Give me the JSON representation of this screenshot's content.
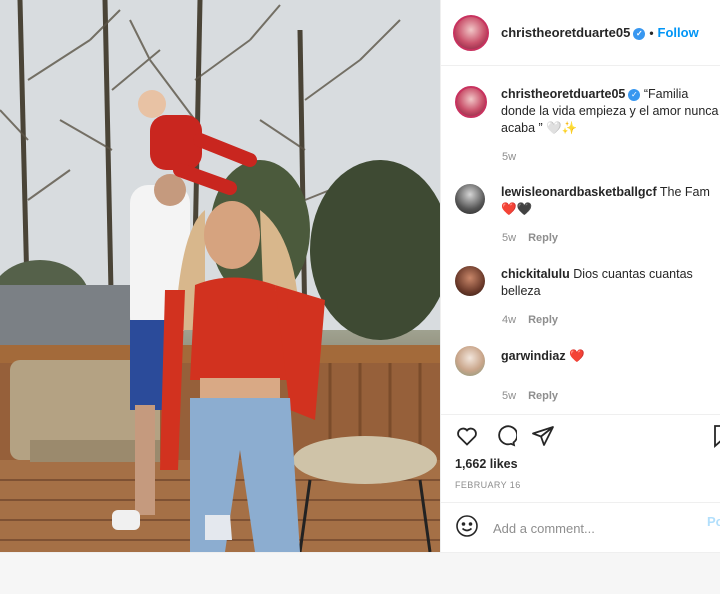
{
  "post": {
    "username": "christheoretduarte05",
    "verified_glyph": "✓",
    "dot": "•",
    "follow_label": "Follow"
  },
  "caption": {
    "username": "christheoretduarte05",
    "text": "“Familia donde la vida empieza y el amor nunca acaba ” 🤍✨",
    "time": "5w"
  },
  "comments": [
    {
      "username": "lewisleonardbasketballgcf",
      "text": "The Fam ❤️🖤",
      "time": "5w",
      "reply_label": "Reply"
    },
    {
      "username": "chickitalulu",
      "text": "Dios cuantas cuantas belleza",
      "time": "4w",
      "reply_label": "Reply"
    },
    {
      "username": "garwindiaz",
      "text": "❤️",
      "time": "5w",
      "reply_label": "Reply"
    }
  ],
  "engagement": {
    "likes": "1,662 likes",
    "date": "FEBRUARY 16"
  },
  "add_comment": {
    "placeholder": "Add a comment...",
    "post_label": "Post"
  },
  "icons": [
    "heart-icon",
    "comment-icon",
    "share-icon",
    "bookmark-icon",
    "emoji-icon"
  ],
  "colors": {
    "accent": "#0095f6",
    "verified": "#3897f0",
    "muted": "#8e8e8e"
  }
}
